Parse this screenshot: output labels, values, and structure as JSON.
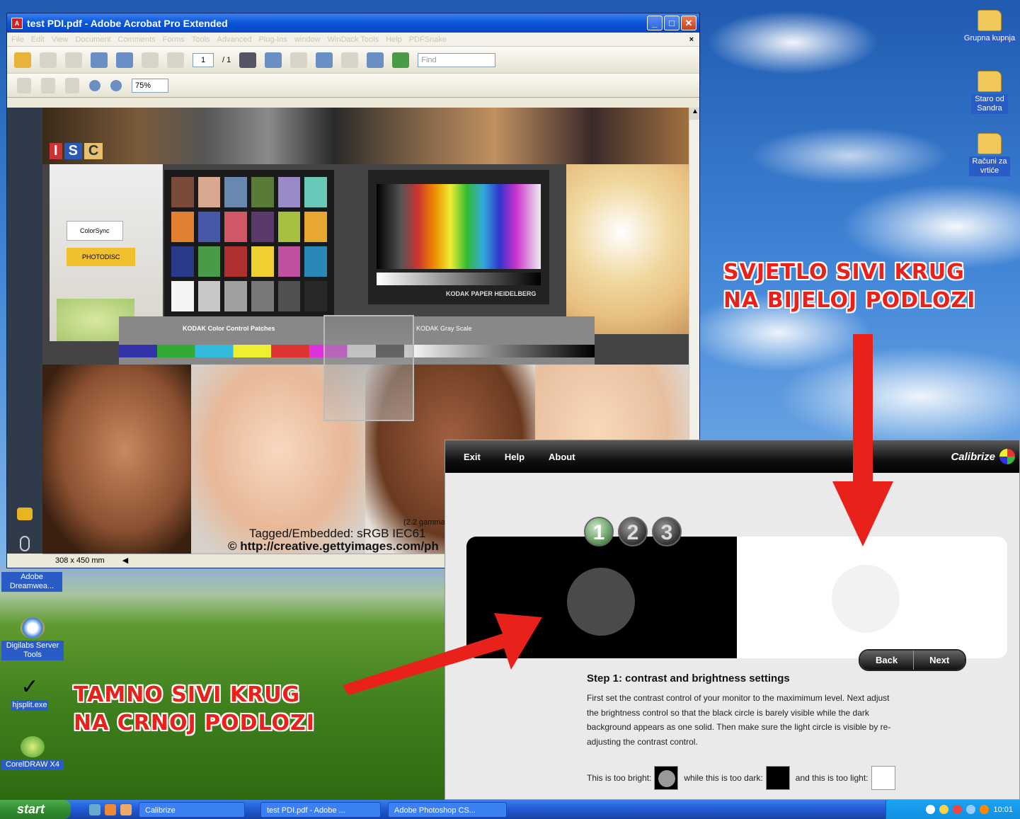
{
  "acrobat": {
    "title": "test PDI.pdf - Adobe Acrobat Pro Extended",
    "menus": [
      "File",
      "Edit",
      "View",
      "Document",
      "Comments",
      "Forms",
      "Tools",
      "Advanced",
      "Plug-Ins",
      "window",
      "WinDack Tools",
      "Help",
      "PDFSnake"
    ],
    "page_current": "1",
    "page_total": "/ 1",
    "find_placeholder": "Find",
    "zoom": "75%",
    "page_size": "308 x 450 mm",
    "doc_caption_line1": "Tagged/Embedded: sRGB IEC61",
    "doc_caption_line2": "© http://creative.gettyimages.com/ph",
    "doc_gamma": "(2.2 gamma",
    "kodak_label": "KODAK Color Control Patches",
    "kodak_gray_label": "KODAK Gray Scale",
    "heidelberg": "KODAK PAPER  HEIDELBERG",
    "colorsync": "ColorSync",
    "photodisc": "PHOTODISC",
    "letters": [
      "I",
      "S",
      "C"
    ]
  },
  "desktop": {
    "icons_right": [
      "Grupna kupnja",
      "Staro od Sandra",
      "Računi za vrtiće"
    ],
    "icons_left": [
      "Adobe Dreamwea...",
      "Digilabs Server Tools",
      "hjsplit.exe",
      "CorelDRAW X4"
    ]
  },
  "calibrize": {
    "menu": [
      "Exit",
      "Help",
      "About"
    ],
    "brand": "Calibrize",
    "steps": [
      "1",
      "2",
      "3"
    ],
    "back": "Back",
    "next": "Next",
    "step_title": "Step 1: contrast and brightness settings",
    "body": "First set the contrast control of your monitor to the maximimum level. Next adjust the brightness control so that the black circle is barely visible while the dark background appears as one solid. Then make sure the light circle is visible by re-adjusting the contrast control.",
    "too_bright": "This is too bright:",
    "too_dark": "while this is too dark:",
    "too_light": "and this is too light:"
  },
  "annotations": {
    "right_line1": "SVJETLO SIVI KRUG",
    "right_line2": "NA BIJELOJ PODLOZI",
    "left_line1": "TAMNO SIVI KRUG",
    "left_line2": "NA CRNOJ PODLOZI",
    "color": "#e8221b"
  },
  "taskbar": {
    "start": "start",
    "tasks": [
      "Calibrize",
      "test PDI.pdf - Adobe ...",
      "Adobe Photoshop CS..."
    ],
    "clock": "10:01"
  }
}
